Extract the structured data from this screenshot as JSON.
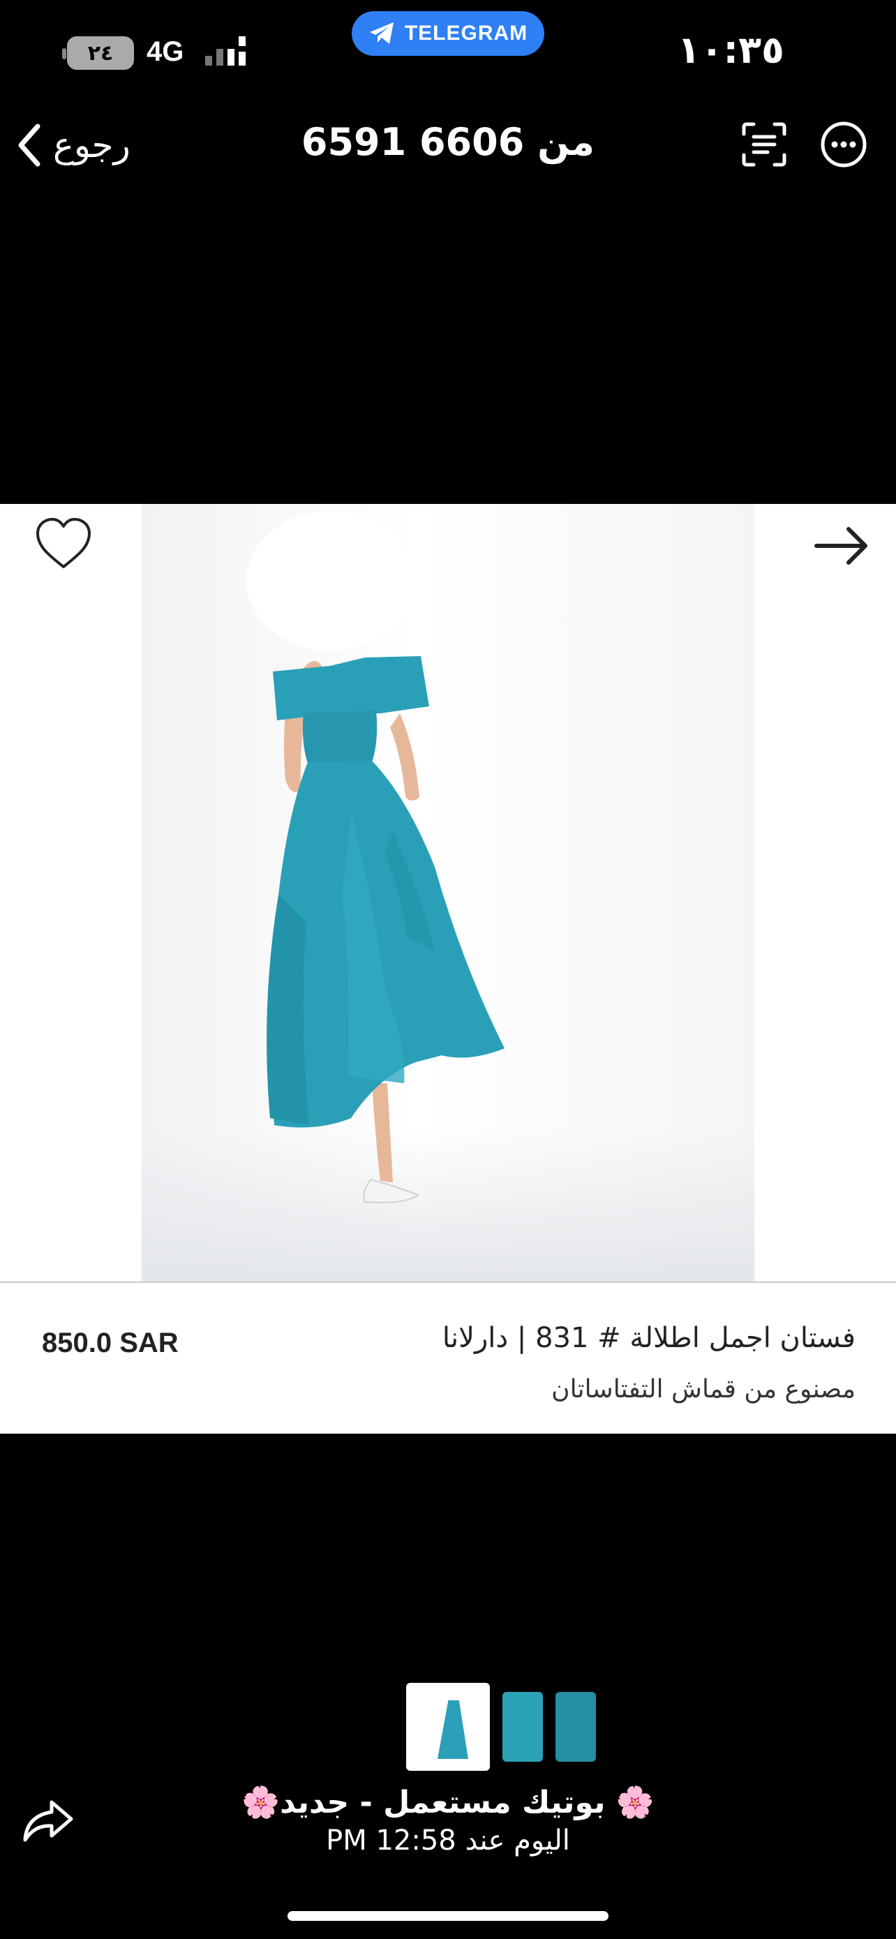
{
  "status_bar": {
    "time": "١٠:٣٥",
    "telegram_label": "TELEGRAM",
    "battery": "٢٤",
    "network": "4G"
  },
  "nav": {
    "back_label": "رجوع",
    "title": "6591 من 6606",
    "icons": [
      "scan-text-icon",
      "more-options-icon"
    ]
  },
  "viewer": {
    "accent_dress_color": "#2aa0b8",
    "icons": [
      "heart-icon",
      "arrow-right-icon"
    ]
  },
  "caption": {
    "title": "فستان اجمل اطلالة # 831 | دارلانا",
    "subtitle": "مصنوع من قماش التفتاساتان",
    "price": "850.0 SAR"
  },
  "thumbnails": {
    "count": 3,
    "active_index": 0
  },
  "footer": {
    "channel_name": "🌸 بوتيك مستعمل - جديد🌸",
    "time": "اليوم عند 12:58 PM",
    "icons": [
      "share-icon"
    ]
  }
}
